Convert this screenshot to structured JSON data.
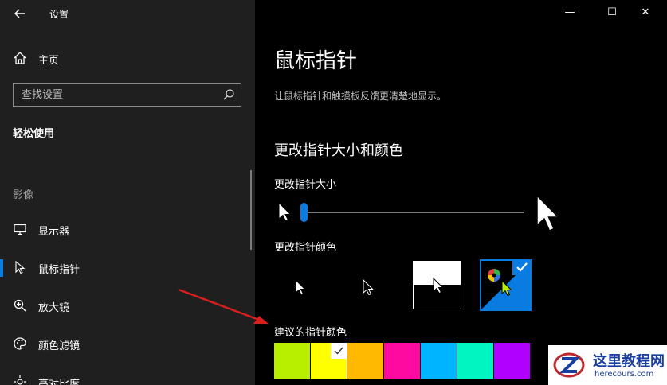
{
  "window": {
    "title": "设置",
    "controls": [
      "—",
      "☐",
      "✕"
    ]
  },
  "sidebar": {
    "home_label": "主页",
    "search_placeholder": "查找设置",
    "section_head": "轻松使用",
    "group_label": "影像",
    "items": [
      {
        "label": "显示器",
        "icon": "monitor-icon",
        "active": false
      },
      {
        "label": "鼠标指针",
        "icon": "mouse-pointer-icon",
        "active": true
      },
      {
        "label": "放大镜",
        "icon": "magnifier-icon",
        "active": false
      },
      {
        "label": "颜色滤镜",
        "icon": "palette-icon",
        "active": false
      },
      {
        "label": "高对比度",
        "icon": "contrast-icon",
        "active": false
      }
    ]
  },
  "main": {
    "title": "鼠标指针",
    "description": "让鼠标指针和触摸板反馈更清楚地显示。",
    "size_color_title": "更改指针大小和颜色",
    "size_label": "更改指针大小",
    "size_level": 0.0,
    "color_label": "更改指针颜色",
    "pointer_options": [
      "white",
      "black",
      "inverted",
      "custom"
    ],
    "selected_pointer": "custom",
    "suggested_label": "建议的指针颜色",
    "suggested_colors": [
      "#b8ee00",
      "#ffff00",
      "#ffb900",
      "#ff0aa0",
      "#00b4ff",
      "#00f5c0",
      "#b000ff"
    ],
    "selected_suggested_index": 1
  },
  "accent_color": "#0a7be0",
  "watermark": {
    "cn": "这里教程网",
    "en": "herecours.com"
  }
}
